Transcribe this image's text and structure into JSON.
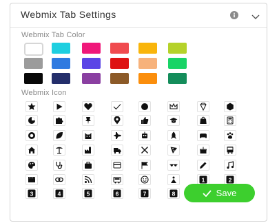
{
  "header": {
    "title": "Webmix Tab Settings"
  },
  "color_section": {
    "label": "Webmix Tab Color"
  },
  "colors": [
    [
      "#ffffff",
      "#1ecfe0",
      "#f0187a",
      "#f04b4f",
      "#f9b50b",
      "#b5d22a"
    ],
    [
      "#9b9b9b",
      "#2f7ae0",
      "#5b45e6",
      "#de1212",
      "#f7b27b",
      "#18d466"
    ],
    [
      "#080808",
      "#242e6b",
      "#8a3fa1",
      "#8c5a28",
      "#fb8e0c",
      "#148d5b"
    ]
  ],
  "icon_section": {
    "label": "Webmix Icon"
  },
  "icons": [
    [
      "star-icon",
      "play-icon",
      "heart-icon",
      "check-mark-icon",
      "circle-icon",
      "crown-icon",
      "diamond-icon",
      "hexagon-icon"
    ],
    [
      "pie-chart-icon",
      "puzzle-icon",
      "pin-icon",
      "map-marker-icon",
      "thumbs-up-icon",
      "graduation-cap-icon",
      "shopping-bag-icon",
      "calculator-icon"
    ],
    [
      "lifebuoy-icon",
      "leaf-icon",
      "cat-icon",
      "airplane-icon",
      "robot-icon",
      "rocket-icon",
      "gamepad-icon",
      "paw-icon"
    ],
    [
      "home-icon",
      "palm-tree-icon",
      "factory-icon",
      "truck-icon",
      "tools-icon",
      "pizza-icon",
      "cake-icon",
      "bus-icon"
    ],
    [
      "palette-icon",
      "stethoscope-icon",
      "briefcase-icon",
      "credit-card-icon",
      "flag-icon",
      "sunglasses-icon",
      "pencil-icon",
      "music-icon"
    ],
    [
      "film-icon",
      "link-icon",
      "rss-icon",
      "truck-small-icon",
      "smiley-icon",
      "bike-icon",
      "number-1-icon",
      "number-2-icon"
    ],
    [
      "number-3-icon",
      "number-4-icon",
      "number-5-icon",
      "number-6-icon",
      "number-7-icon",
      "number-8-icon",
      "number-9-icon",
      "empty-slot"
    ]
  ],
  "number_labels": {
    "number-1-icon": "1",
    "number-2-icon": "2",
    "number-3-icon": "3",
    "number-4-icon": "4",
    "number-5-icon": "5",
    "number-6-icon": "6",
    "number-7-icon": "7",
    "number-8-icon": "8",
    "number-9-icon": "9"
  },
  "save_button": {
    "label": "Save"
  },
  "colors_accent": {
    "save": "#3dcf2e"
  }
}
